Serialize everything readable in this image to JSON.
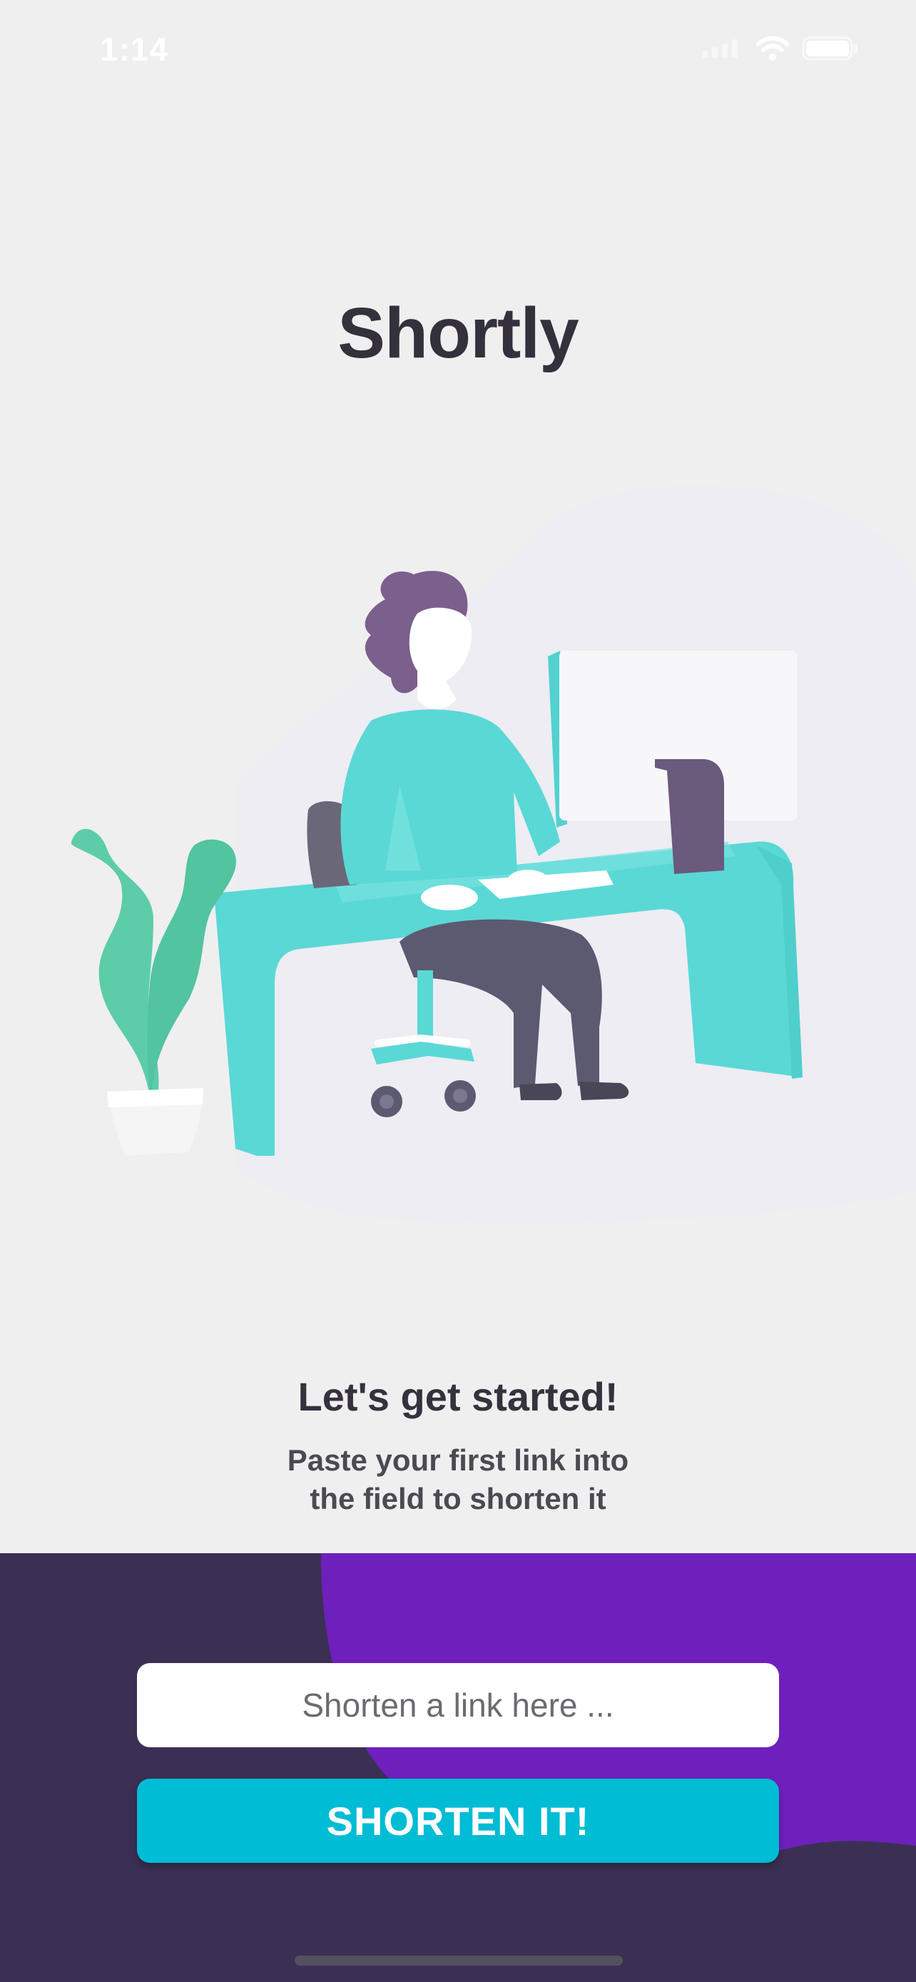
{
  "status_bar": {
    "time": "1:14",
    "icons": [
      "signal-icon",
      "wifi-icon",
      "battery-icon"
    ]
  },
  "app": {
    "title": "Shortly"
  },
  "illustration": {
    "name": "person-working-at-desk-illustration"
  },
  "onboarding": {
    "heading": "Let's get started!",
    "subtext_lines": [
      "Paste your first link into",
      "the field to shorten it"
    ]
  },
  "form": {
    "input_placeholder": "Shorten a link here ...",
    "input_value": "",
    "button_label": "SHORTEN IT!"
  },
  "colors": {
    "background": "#efefef",
    "title_text": "#34313d",
    "panel_dark": "#3b3054",
    "panel_purple": "#6f20bc",
    "button_cyan": "#00bcd4",
    "button_text": "#ffffff"
  }
}
